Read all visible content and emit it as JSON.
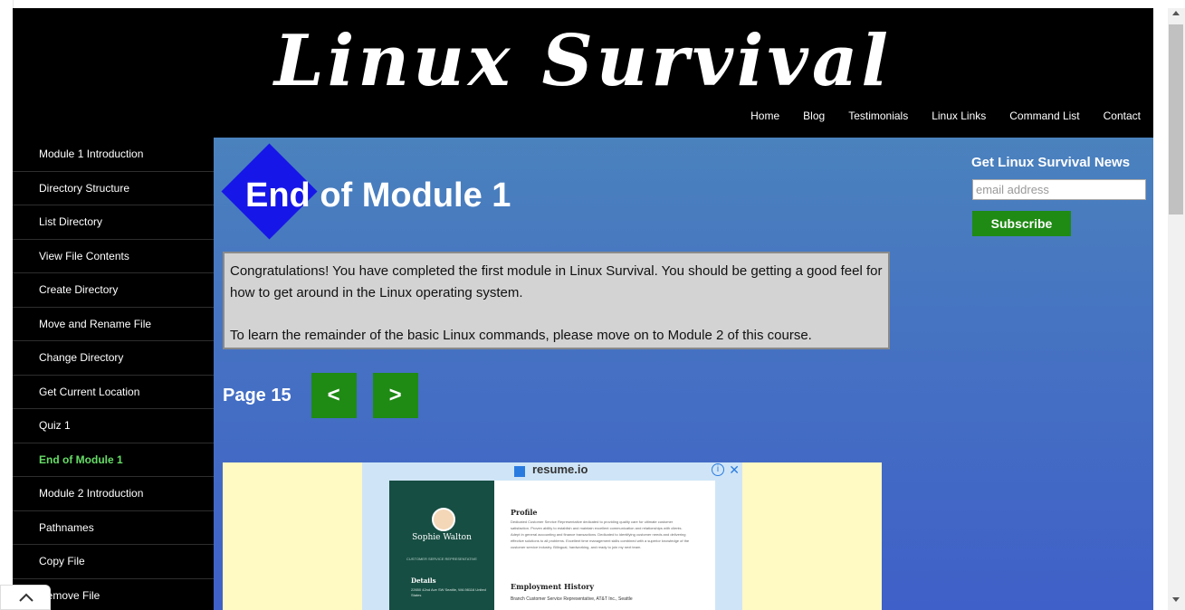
{
  "header": {
    "logo_text": "Linux Survival",
    "nav": [
      "Home",
      "Blog",
      "Testimonials",
      "Linux Links",
      "Command List",
      "Contact"
    ]
  },
  "sidebar": {
    "items": [
      {
        "label": "Module 1 Introduction"
      },
      {
        "label": "Directory Structure"
      },
      {
        "label": "List Directory"
      },
      {
        "label": "View File Contents"
      },
      {
        "label": "Create Directory"
      },
      {
        "label": "Move and Rename File"
      },
      {
        "label": "Change Directory"
      },
      {
        "label": "Get Current Location"
      },
      {
        "label": "Quiz 1"
      },
      {
        "label": "End of Module 1",
        "active": true
      },
      {
        "label": "Module 2 Introduction"
      },
      {
        "label": "Pathnames"
      },
      {
        "label": "Copy File"
      },
      {
        "label": "Remove File"
      }
    ]
  },
  "main": {
    "title": "End of Module 1",
    "message": {
      "p1": "Congratulations! You have completed the first module in Linux Survival. You should be getting a good feel for how to get around in the Linux operating system.",
      "p2": "To learn the remainder of the basic Linux commands, please move on to Module 2 of this course."
    },
    "pager": {
      "label": "Page 15",
      "prev": "<",
      "next": ">"
    }
  },
  "newsletter": {
    "title": "Get Linux Survival News",
    "email_placeholder": "email address",
    "subscribe_label": "Subscribe"
  },
  "ad": {
    "brand": "resume.io",
    "info": "i",
    "close": "✕",
    "resume": {
      "name": "Sophie Walton",
      "role": "CUSTOMER SERVICE REPRESENTATIVE",
      "details_heading": "Details",
      "address": "22650 42nd Ave SW\nSeattle, WA 98116\nUnited States",
      "profile_heading": "Profile",
      "profile_text": "Dedicated Customer Service Representative dedicated to providing quality care for ultimate customer satisfaction. Proven ability to establish and maintain excellent communication and relationships with clients. Adept in general accounting and finance transactions. Dedicated to identifying customer needs and delivering effective solutions to all problems. Excellent time management skills combined with a superior knowledge of the customer service industry. Bilingual, hardworking, and ready to join my next team.",
      "history_heading": "Employment History",
      "job": "Branch Customer Service Representative, AT&T Inc., Seattle"
    }
  },
  "colors": {
    "header_bg": "#000000",
    "sidebar_active": "#66dd66",
    "main_gradient_top": "#4a82bd",
    "main_gradient_bottom": "#3f60c8",
    "button_green": "#1f8a14",
    "diamond": "#1616e8",
    "message_bg": "#d3d3d3"
  },
  "icons": {
    "back_to_top": "chevron-up-icon"
  }
}
